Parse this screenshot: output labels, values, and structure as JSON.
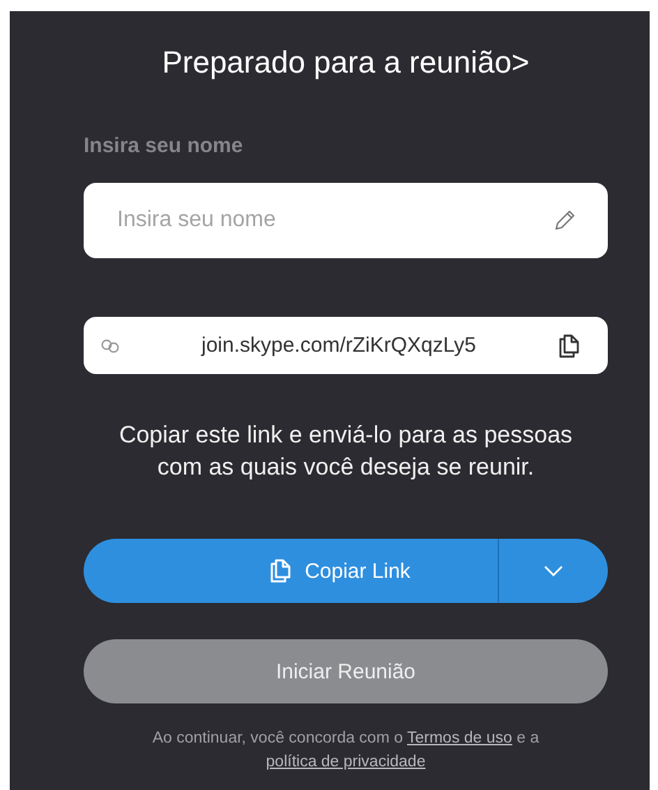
{
  "title": "Preparado para a reunião>",
  "name_field": {
    "label": "Insira seu nome",
    "placeholder": "Insira seu nome"
  },
  "link_field": {
    "value": "join.skype.com/rZiKrQXqzLy5"
  },
  "description": "Copiar este link e enviá-lo para as pessoas com as quais você deseja se reunir.",
  "copy_button": {
    "label": "Copiar Link"
  },
  "start_button": {
    "label": "Iniciar Reunião",
    "disabled": true
  },
  "footer": {
    "text_before": "Ao continuar, você concorda com o",
    "terms_link": "Termos de uso",
    "text_middle": "e a",
    "privacy_link": "política de privacidade"
  }
}
